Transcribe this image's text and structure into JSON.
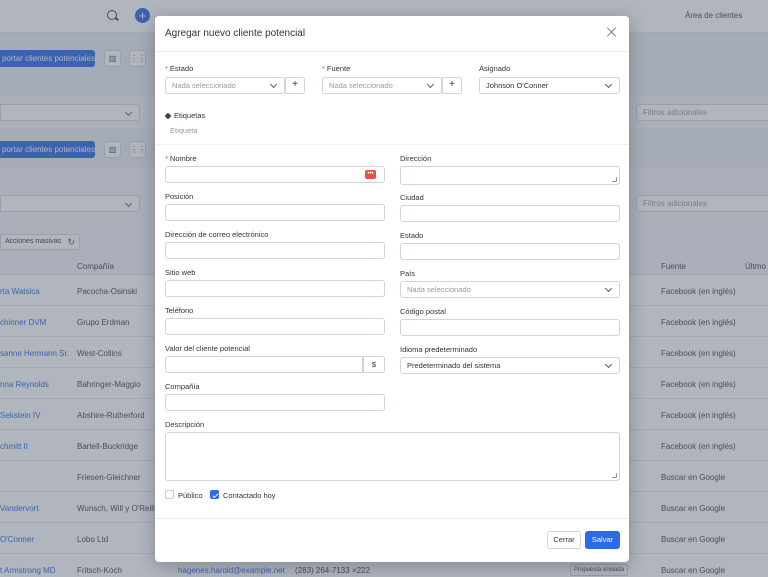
{
  "background": {
    "top_link": "Área de clientes",
    "import_button": "portar clientes potenciales",
    "filters_placeholder": "Filtros adicionales",
    "bulk_actions": "Acciones masivas",
    "columns": {
      "company": "Compañía",
      "source": "Fuente",
      "last": "Últmo"
    },
    "rows": [
      {
        "name": "rta Watsica",
        "company": "Pacocha-Osinski",
        "source": "Facebook (en inglés)"
      },
      {
        "name": "chinner DVM",
        "company": "Grupo Erdman",
        "source": "Facebook (en inglés)"
      },
      {
        "name": "sanne Hermann Sr.",
        "company": "West-Collins",
        "source": "Facebook (en inglés)"
      },
      {
        "name": "nna Reynolds",
        "company": "Bahringer-Maggio",
        "source": "Facebook (en inglés)"
      },
      {
        "name": "Sekstein IV",
        "company": "Abshire-Rutherford",
        "source": "Facebook (en inglés)"
      },
      {
        "name": "chmitt II",
        "company": "Bartell-Buckridge",
        "source": "Facebook (en inglés)"
      },
      {
        "name": "",
        "company": "Friesen-Gleichner",
        "source": "Buscar en Google"
      },
      {
        "name": "Vandervort",
        "company": "Wunsch, Will y O'Reilly",
        "source": "Buscar en Google"
      },
      {
        "name": "O'Conner",
        "company": "Lobo Ltd",
        "source": "Buscar en Google"
      },
      {
        "name": "t Armstrong MD",
        "company": "Fritsch-Koch",
        "source": "Buscar en Google",
        "email": "hagenes.harold@example.net",
        "phone": "(283) 264-7133 ×222",
        "status": "Propuesta enviada"
      }
    ]
  },
  "modal": {
    "title": "Agregar nuevo cliente potencial",
    "estado_label": "Estado",
    "estado_value": "Nada seleccionado",
    "fuente_label": "Fuente",
    "fuente_value": "Nada seleccionado",
    "asignado_label": "Asignado",
    "asignado_value": "Johnson O'Conner",
    "add_symbol": "+",
    "etiquetas_label": "Etiquetas",
    "etiquetas_placeholder": "Etiqueta",
    "nombre_label": "Nombre",
    "posicion_label": "Posición",
    "email_label": "Dirección de correo electrónico",
    "web_label": "Sitio web",
    "telefono_label": "Teléfono",
    "valor_label": "Valor del cliente potencial",
    "currency_symbol": "$",
    "compania_label": "Compañía",
    "direccion_label": "Dirección",
    "ciudad_label": "Ciudad",
    "estado2_label": "Estado",
    "pais_label": "País",
    "pais_value": "Nada seleccionado",
    "postal_label": "Código postal",
    "idioma_label": "Idioma predeterminado",
    "idioma_value": "Predeterminado del sistema",
    "descripcion_label": "Descripción",
    "publico_label": "Público",
    "contactado_label": "Contactado hoy",
    "publico_checked": false,
    "contactado_checked": true,
    "dots": "•••",
    "cerrar": "Cerrar",
    "salvar": "Salvar"
  },
  "colors": {
    "accent": "#2b6be6",
    "required": "#e04848"
  }
}
